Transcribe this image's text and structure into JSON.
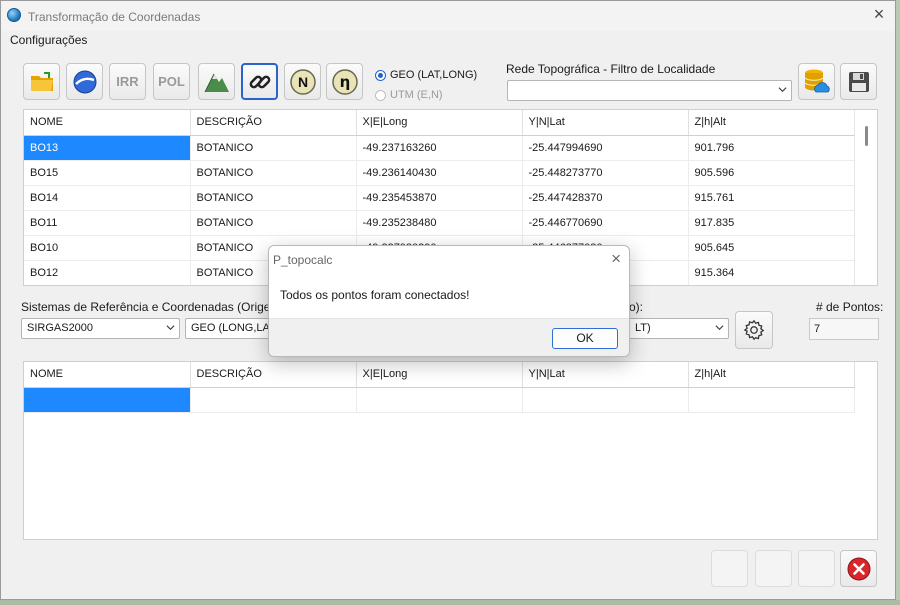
{
  "window": {
    "title": "Transformação de Coordenadas",
    "menu": [
      "Configurações"
    ]
  },
  "toolbar": {
    "buttons": [
      {
        "name": "open-folder",
        "label": ""
      },
      {
        "name": "google-earth",
        "label": ""
      },
      {
        "name": "irr",
        "label": "IRR"
      },
      {
        "name": "pol",
        "label": "POL"
      },
      {
        "name": "terrain",
        "label": ""
      },
      {
        "name": "connect-link",
        "label": ""
      },
      {
        "name": "north",
        "label": "N"
      },
      {
        "name": "eta",
        "label": "η"
      }
    ],
    "coord_mode": {
      "option1": "GEO (LAT,LONG)",
      "option2": "UTM (E,N)",
      "selected": "GEO (LAT,LONG)"
    },
    "rede_label": "Rede Topográfica - Filtro de Localidade",
    "rede_value": ""
  },
  "grid_top": {
    "columns": [
      "NOME",
      "DESCRIÇÃO",
      "X|E|Long",
      "Y|N|Lat",
      "Z|h|Alt"
    ],
    "rows": [
      [
        "BO13",
        "BOTANICO",
        "-49.237163260",
        "-25.447994690",
        "901.796"
      ],
      [
        "BO15",
        "BOTANICO",
        "-49.236140430",
        "-25.448273770",
        "905.596"
      ],
      [
        "BO14",
        "BOTANICO",
        "-49.235453870",
        "-25.447428370",
        "915.761"
      ],
      [
        "BO11",
        "BOTANICO",
        "-49.235238480",
        "-25.446770690",
        "917.835"
      ],
      [
        "BO10",
        "BOTANICO",
        "-49.237080290",
        "-25.446877080",
        "905.645"
      ],
      [
        "BO12",
        "BOTANICO",
        "",
        "",
        "915.364"
      ]
    ]
  },
  "origin": {
    "label": "Sistemas de Referência e Coordenadas (Origem):",
    "datum": "SIRGAS2000",
    "format": "GEO (LONG,LAT,",
    "dest_label_tail": "o):",
    "dest_format_tail": "LT)",
    "points_label": "# de Pontos:",
    "points_value": "7"
  },
  "grid_bottom": {
    "columns": [
      "NOME",
      "DESCRIÇÃO",
      "X|E|Long",
      "Y|N|Lat",
      "Z|h|Alt"
    ]
  },
  "dialog": {
    "title": "P_topocalc",
    "message": "Todos os pontos foram conectados!",
    "ok_label": "OK"
  },
  "colors": {
    "selection": "#1e88ff",
    "accent": "#2f6fd4",
    "close_red": "#d9262a"
  }
}
